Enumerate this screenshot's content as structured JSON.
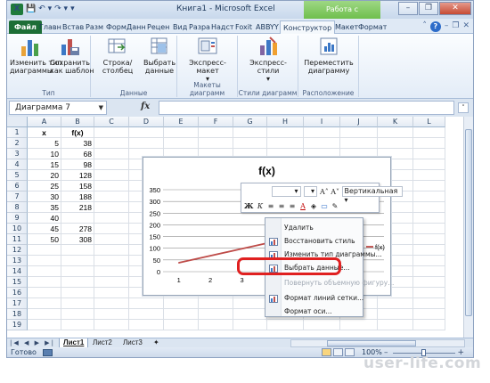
{
  "window": {
    "title": "Книга1 - Microsoft Excel",
    "context_title": "Работа с диаграммами",
    "minimize": "–",
    "restore": "❐",
    "close": "✕"
  },
  "qat": {
    "logo": "X",
    "save": "💾",
    "undo": "↶ ▾",
    "redo": "↷ ▾",
    "custom": "▾"
  },
  "tabs": [
    "Файл",
    "Главн",
    "Встав",
    "Разм",
    "Форм",
    "Данн",
    "Рецен",
    "Вид",
    "Разра",
    "Надст",
    "Foxit",
    "ABBYY",
    "Конструктор",
    "Макет",
    "Формат"
  ],
  "active_tab": "Конструктор",
  "ribbon": {
    "groups": [
      {
        "label": "Тип",
        "buttons": [
          "Изменить тип\nдиаграммы",
          "Сохранить\nкак шаблон"
        ]
      },
      {
        "label": "Данные",
        "buttons": [
          "Строка/столбец",
          "Выбрать\nданные"
        ]
      },
      {
        "label": "Макеты диаграмм",
        "buttons": [
          "Экспресс-макет"
        ]
      },
      {
        "label": "Стили диаграмм",
        "buttons": [
          "Экспресс-стили"
        ]
      },
      {
        "label": "Расположение",
        "buttons": [
          "Переместить\nдиаграмму"
        ]
      }
    ]
  },
  "formula_bar": {
    "name_box": "Диаграмма 7",
    "fx": "fx",
    "formula": ""
  },
  "columns": [
    "A",
    "B",
    "C",
    "D",
    "E",
    "F",
    "G",
    "H",
    "I",
    "J",
    "K",
    "L"
  ],
  "rows": [
    "1",
    "2",
    "3",
    "4",
    "5",
    "6",
    "7",
    "8",
    "9",
    "10",
    "11",
    "12",
    "13",
    "14",
    "15",
    "16",
    "17",
    "18",
    "19"
  ],
  "cells": {
    "header": [
      "x",
      "f(x)"
    ],
    "data": [
      [
        "5",
        "38"
      ],
      [
        "10",
        "68"
      ],
      [
        "15",
        "98"
      ],
      [
        "20",
        "128"
      ],
      [
        "25",
        "158"
      ],
      [
        "30",
        "188"
      ],
      [
        "35",
        "218"
      ],
      [
        "40",
        ""
      ],
      [
        "45",
        "278"
      ],
      [
        "50",
        "308"
      ]
    ]
  },
  "chart_data": {
    "type": "line",
    "title": "f(x)",
    "categories": [
      "1",
      "2",
      "3",
      "4",
      "5"
    ],
    "series": [
      {
        "name": "f(x)",
        "values": [
          38,
          68,
          98,
          128,
          158
        ]
      }
    ],
    "ylim": [
      0,
      350
    ],
    "yticks": [
      "0",
      "50",
      "100",
      "150",
      "200",
      "250",
      "300",
      "350"
    ],
    "grid": true,
    "line_color": "#be4b48"
  },
  "mini_toolbar": {
    "font_dropdown": "▾",
    "size_dropdown": "▾",
    "grow": "A˄",
    "shrink": "A˅",
    "orientation": "Вертикальная",
    "bold": "Ж",
    "italic": "К",
    "align": [
      "≡",
      "≡",
      "≡"
    ],
    "font_color": "A",
    "fill": "◈",
    "outline": "▭",
    "brush": "✎"
  },
  "context_menu": {
    "items": [
      {
        "label": "Удалить",
        "enabled": true
      },
      {
        "label": "Восстановить стиль",
        "enabled": true
      },
      {
        "label": "Изменить тип диаграммы...",
        "enabled": true
      },
      {
        "label": "Выбрать данные...",
        "enabled": true
      },
      {
        "label": "Повернуть объемную фигуру...",
        "enabled": false
      },
      {
        "label": "Формат линий сетки...",
        "enabled": true
      },
      {
        "label": "Формат оси...",
        "enabled": true
      }
    ]
  },
  "sheets": [
    "Лист1",
    "Лист2",
    "Лист3"
  ],
  "active_sheet": "Лист1",
  "status": {
    "ready": "Готово",
    "zoom": "100%",
    "zoom_minus": "–",
    "zoom_plus": "+"
  },
  "watermark": "user-life.com"
}
